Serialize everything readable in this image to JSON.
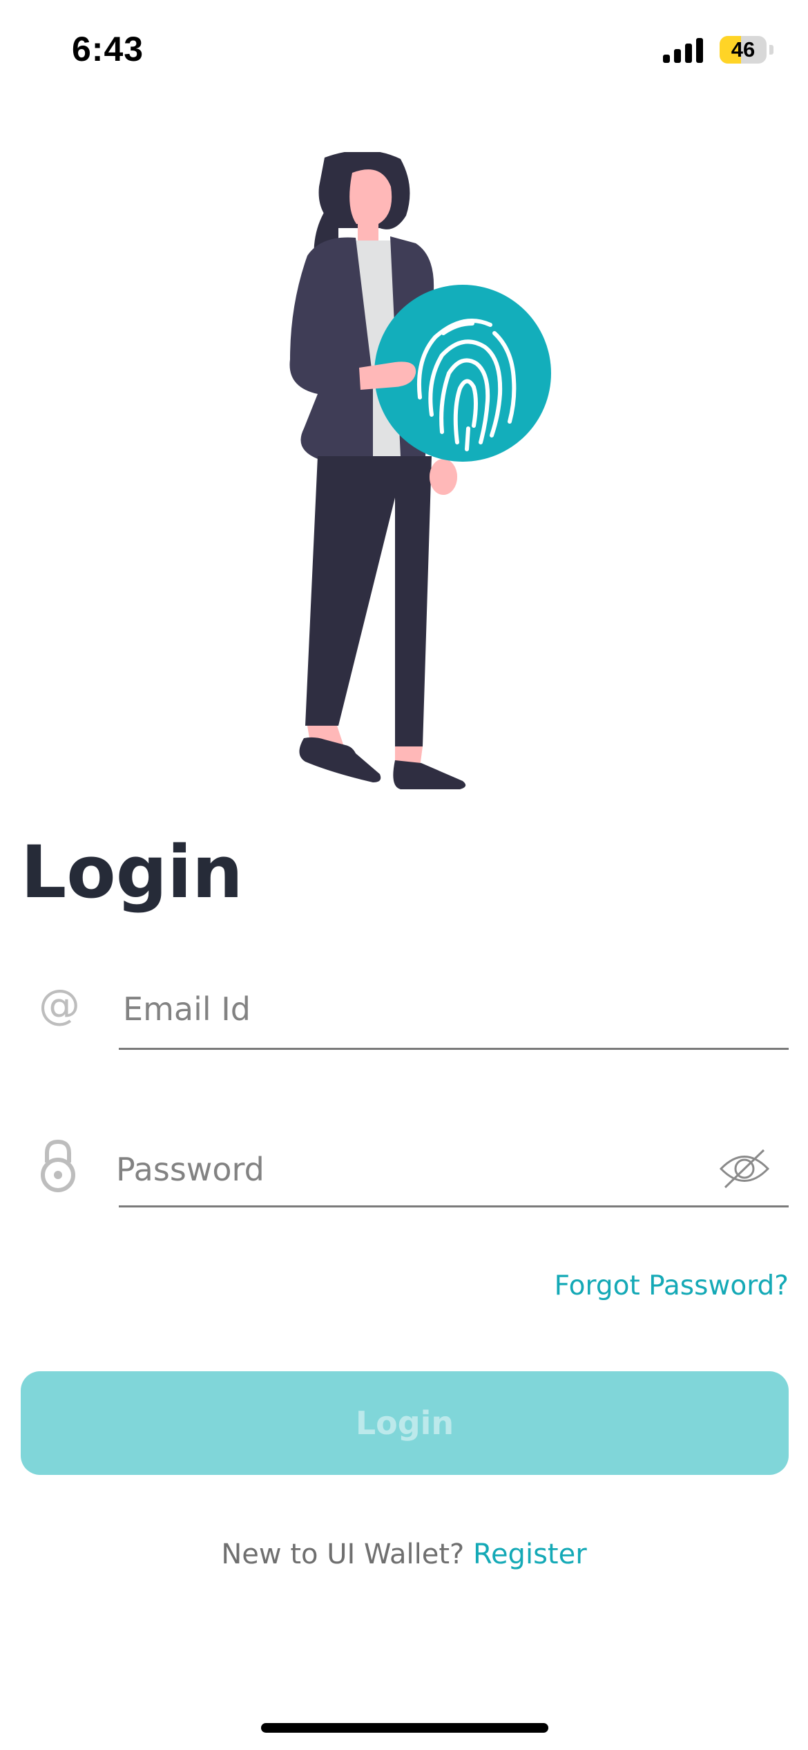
{
  "status_bar": {
    "time": "6:43",
    "battery_level": "46",
    "battery_fraction": 0.46,
    "signal_bars": 4,
    "icons": [
      "signal-icon",
      "battery-icon"
    ]
  },
  "illustration": {
    "icon": "fingerprint-icon",
    "colors": {
      "accent": "#13aebb",
      "clothing": "#3f3d56",
      "skin": "#ffb8b8",
      "shirt": "#e1e2e3"
    }
  },
  "title": "Login",
  "email": {
    "icon": "at-sign-icon",
    "icon_glyph": "@",
    "placeholder": "Email Id",
    "value": ""
  },
  "password": {
    "icon": "lock-icon",
    "placeholder": "Password",
    "value": "",
    "toggle_icon": "eye-off-icon"
  },
  "forgot_password": "Forgot Password?",
  "login_button": "Login",
  "register": {
    "prompt": "New to UI Wallet? ",
    "link": "Register"
  },
  "colors": {
    "accent": "#14a9b6",
    "button_disabled": "#80d6d9",
    "title": "#262b38"
  }
}
